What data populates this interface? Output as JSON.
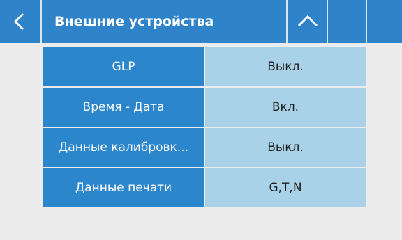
{
  "header": {
    "title": "Внешние устройства",
    "back_icon": "chevron-left-icon",
    "up_icon": "chevron-up-icon"
  },
  "settings": [
    {
      "name": "GLP",
      "value": "Выкл."
    },
    {
      "name": "Время - Дата",
      "value": "Вкл."
    },
    {
      "name": "Данные калибровк...",
      "value": "Выкл."
    },
    {
      "name": "Данные печати",
      "value": "G,T,N"
    }
  ],
  "colors": {
    "header_bg": "#2f83c8",
    "name_cell_bg": "#2b86cb",
    "value_cell_bg": "#a9d2e8",
    "page_bg": "#ececec"
  }
}
